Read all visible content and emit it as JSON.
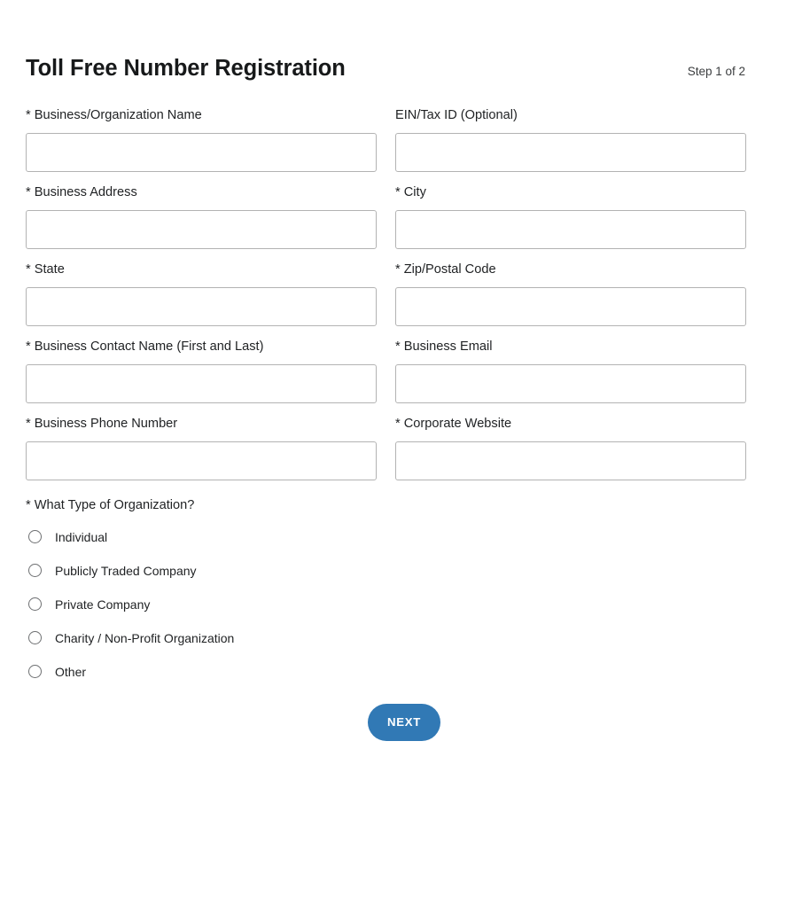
{
  "header": {
    "title": "Toll Free Number Registration",
    "step_indicator": "Step 1 of 2"
  },
  "form": {
    "fields": [
      {
        "label": "* Business/Organization Name",
        "value": "",
        "placeholder": "",
        "name": "business-organization-name"
      },
      {
        "label": "EIN/Tax ID (Optional)",
        "value": "",
        "placeholder": "",
        "name": "ein-tax-id"
      },
      {
        "label": "* Business Address",
        "value": "",
        "placeholder": "",
        "name": "business-address"
      },
      {
        "label": "* City",
        "value": "",
        "placeholder": "",
        "name": "city"
      },
      {
        "label": "* State",
        "value": "",
        "placeholder": "",
        "name": "state"
      },
      {
        "label": "* Zip/Postal Code",
        "value": "",
        "placeholder": "",
        "name": "zip-postal-code"
      },
      {
        "label": "* Business Contact Name (First and Last)",
        "value": "",
        "placeholder": "",
        "name": "business-contact-name"
      },
      {
        "label": "* Business Email",
        "value": "",
        "placeholder": "",
        "name": "business-email"
      },
      {
        "label": "* Business Phone Number",
        "value": "",
        "placeholder": "",
        "name": "business-phone-number"
      },
      {
        "label": "* Corporate Website",
        "value": "",
        "placeholder": "",
        "name": "corporate-website"
      }
    ],
    "organization_type": {
      "label": "* What Type of Organization?",
      "selected": null,
      "options": [
        {
          "label": "Individual",
          "checked": false
        },
        {
          "label": "Publicly Traded Company",
          "checked": false
        },
        {
          "label": "Private Company",
          "checked": false
        },
        {
          "label": "Charity / Non-Profit Organization",
          "checked": false
        },
        {
          "label": "Other",
          "checked": false
        }
      ]
    }
  },
  "footer": {
    "next_label": "NEXT"
  },
  "colors": {
    "accent": "#3179b5",
    "text": "#1f2123",
    "border": "#b3b3b3",
    "background": "#ffffff"
  }
}
